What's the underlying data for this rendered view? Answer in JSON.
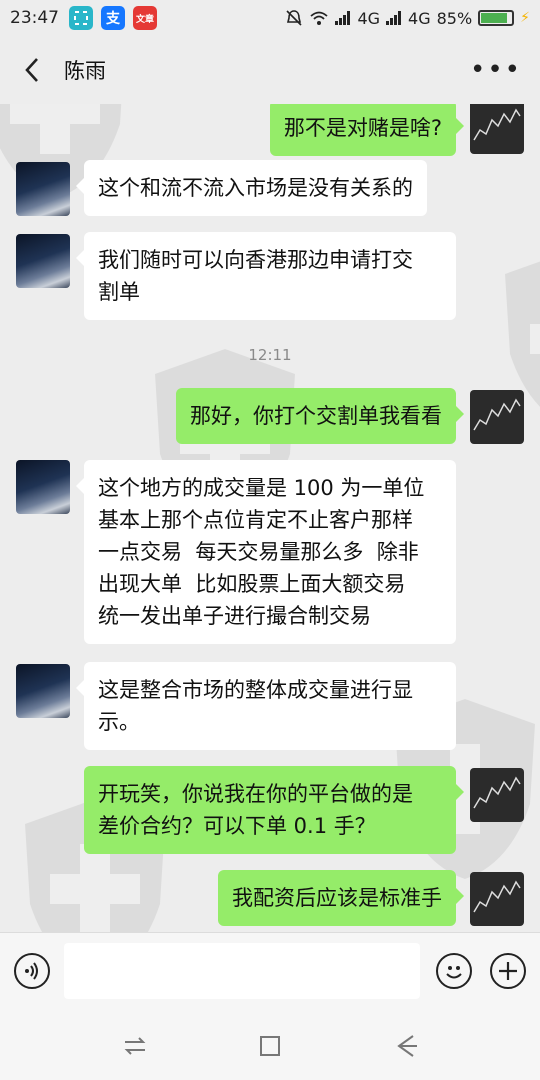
{
  "status_bar": {
    "time": "23:47",
    "signal1": "4G",
    "signal2": "4G",
    "battery": "85%",
    "battery_level": 0.85,
    "app_icons": [
      "scan-app-icon",
      "alipay-icon",
      "news-app-icon"
    ],
    "app_badge_text": "支",
    "news_badge_text": "文章"
  },
  "header": {
    "title": "陈雨"
  },
  "messages": [
    {
      "side": "out",
      "text": "那不是对赌是啥?"
    },
    {
      "side": "in",
      "text": "这个和流不流入市场是没有关系的"
    },
    {
      "side": "in",
      "text": "我们随时可以向香港那边申请打交\n割单"
    },
    {
      "timestamp": "12:11"
    },
    {
      "side": "out",
      "text": "那好，你打个交割单我看看"
    },
    {
      "side": "in",
      "text": "这个地方的成交量是 100 为一单位\n基本上那个点位肯定不止客户那样\n一点交易  每天交易量那么多  除非\n出现大单  比如股票上面大额交易\n统一发出单子进行撮合制交易"
    },
    {
      "side": "in",
      "text": "这是整合市场的整体成交量进行显\n示。"
    },
    {
      "side": "out",
      "text": "开玩笑，你说我在你的平台做的是\n差价合约？可以下单 0.1 手？"
    },
    {
      "side": "out",
      "text": "我配资后应该是标准手"
    }
  ],
  "input": {
    "value": "",
    "placeholder": ""
  },
  "colors": {
    "out_bubble": "#95ec69",
    "in_bubble": "#ffffff",
    "background": "#ededed"
  }
}
